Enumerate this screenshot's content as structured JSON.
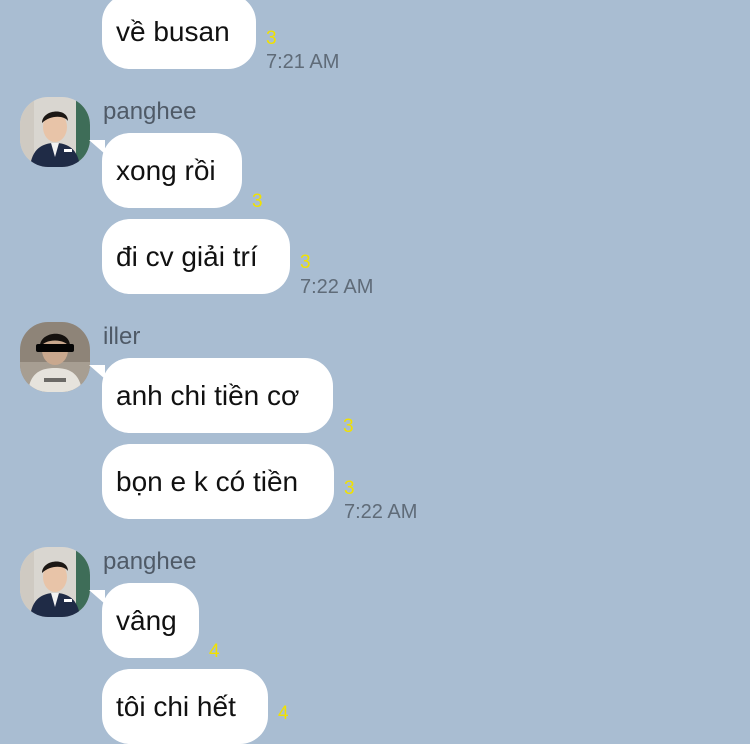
{
  "messages": [
    {
      "text": "về busan",
      "count": "3",
      "time": "7:21 AM"
    },
    {
      "text": "xong rồi",
      "count": "3"
    },
    {
      "text": "đi cv giải trí",
      "count": "3",
      "time": "7:22 AM"
    },
    {
      "text": "anh chi tiền cơ",
      "count": "3"
    },
    {
      "text": "bọn e k có tiền",
      "count": "3",
      "time": "7:22 AM"
    },
    {
      "text": "vâng",
      "count": "4"
    },
    {
      "text": "tôi chi hết",
      "count": "4"
    }
  ],
  "senders": [
    {
      "name": "panghee",
      "avatar_icon": "profile-photo-panghee"
    },
    {
      "name": "iller",
      "avatar_icon": "profile-photo-iller"
    },
    {
      "name": "panghee",
      "avatar_icon": "profile-photo-panghee"
    }
  ],
  "colors": {
    "background": "#a9bdd2",
    "bubble": "#ffffff",
    "unread_count": "#f1e100",
    "timestamp": "#5f6b78",
    "sender_name": "#4f5a67"
  }
}
